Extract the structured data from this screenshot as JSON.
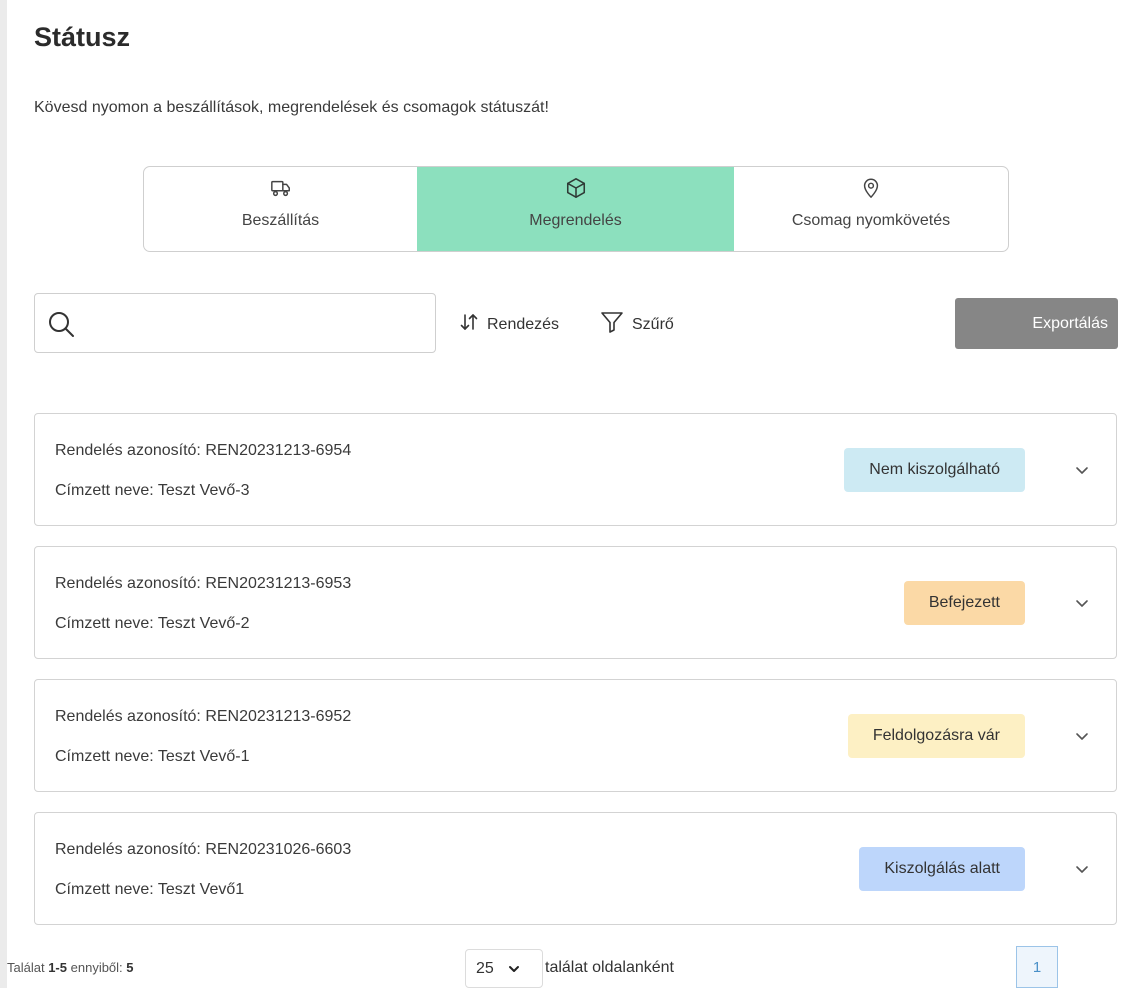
{
  "header": {
    "title": "Státusz",
    "subtitle": "Kövesd nyomon a beszállítások, megrendelések és csomagok státuszát!"
  },
  "tabs": [
    {
      "label": "Beszállítás",
      "icon": "truck-icon",
      "active": false
    },
    {
      "label": "Megrendelés",
      "icon": "box-icon",
      "active": true
    },
    {
      "label": "Csomag nyomkövetés",
      "icon": "map-pin-icon",
      "active": false
    }
  ],
  "toolbar": {
    "search_value": "",
    "search_placeholder": "",
    "sort_label": "Rendezés",
    "filter_label": "Szűrő",
    "export_label": "Exportálás"
  },
  "orders": [
    {
      "id_text": "Rendelés azonosító: REN20231213-6954",
      "recipient_text": "Címzett neve: Teszt Vevő-3",
      "status": "Nem kiszolgálható",
      "status_color": "#cdeaf3"
    },
    {
      "id_text": "Rendelés azonosító: REN20231213-6953",
      "recipient_text": "Címzett neve: Teszt Vevő-2",
      "status": "Befejezett",
      "status_color": "#fbd9a6"
    },
    {
      "id_text": "Rendelés azonosító: REN20231213-6952",
      "recipient_text": "Címzett neve: Teszt Vevő-1",
      "status": "Feldolgozásra vár",
      "status_color": "#fdf0c4"
    },
    {
      "id_text": "Rendelés azonosító: REN20231026-6603",
      "recipient_text": "Címzett neve: Teszt Vevő1",
      "status": "Kiszolgálás alatt",
      "status_color": "#bdd6fb"
    }
  ],
  "pagination": {
    "result_prefix": "Találat",
    "result_range": "1-5",
    "result_mid": "ennyiből:",
    "result_total": "5",
    "page_size": "25",
    "page_size_label": "találat oldalanként",
    "current_page": "1"
  },
  "colors": {
    "accent": "#8ce0be",
    "export_button": "#868686"
  }
}
